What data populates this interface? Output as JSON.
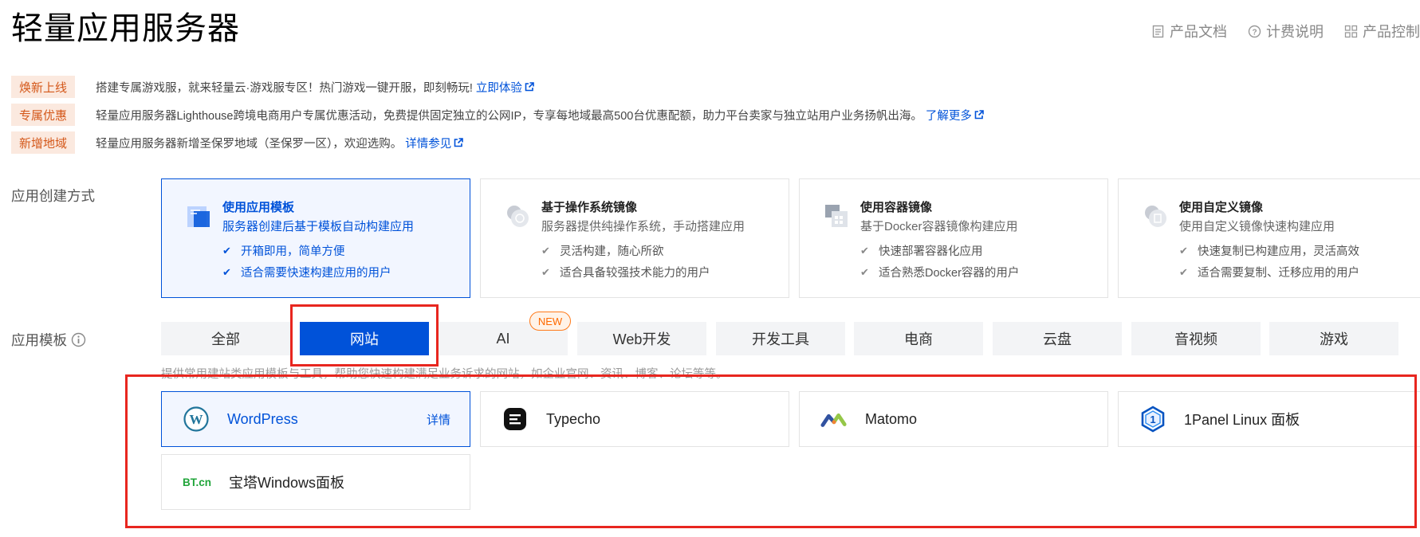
{
  "page": {
    "title": "轻量应用服务器"
  },
  "top_links": [
    {
      "label": "产品文档",
      "icon": "document-icon"
    },
    {
      "label": "计费说明",
      "icon": "question-circle-icon"
    },
    {
      "label": "产品控制台",
      "icon": "grid-icon"
    }
  ],
  "notices": [
    {
      "tag": "焕新上线",
      "text": "搭建专属游戏服，就来轻量云·游戏服专区！热门游戏一键开服，即刻畅玩!",
      "link": "立即体验"
    },
    {
      "tag": "专属优惠",
      "text": "轻量应用服务器Lighthouse跨境电商用户专属优惠活动，免费提供固定独立的公网IP，专享每地域最高500台优惠配额，助力平台卖家与独立站用户业务扬帆出海。",
      "link": "了解更多"
    },
    {
      "tag": "新增地域",
      "text": "轻量应用服务器新增圣保罗地域（圣保罗一区），欢迎选购。",
      "link": "详情参见"
    }
  ],
  "creation": {
    "label": "应用创建方式",
    "methods": [
      {
        "title": "使用应用模板",
        "desc": "服务器创建后基于模板自动构建应用",
        "features": [
          "开箱即用，简单方便",
          "适合需要快速构建应用的用户"
        ]
      },
      {
        "title": "基于操作系统镜像",
        "desc": "服务器提供纯操作系统，手动搭建应用",
        "features": [
          "灵活构建，随心所欲",
          "适合具备较强技术能力的用户"
        ]
      },
      {
        "title": "使用容器镜像",
        "desc": "基于Docker容器镜像构建应用",
        "features": [
          "快速部署容器化应用",
          "适合熟悉Docker容器的用户"
        ]
      },
      {
        "title": "使用自定义镜像",
        "desc": "使用自定义镜像快速构建应用",
        "features": [
          "快速复制已构建应用，灵活高效",
          "适合需要复制、迁移应用的用户"
        ]
      }
    ]
  },
  "templates": {
    "label": "应用模板",
    "tabs": [
      "全部",
      "网站",
      "AI",
      "Web开发",
      "开发工具",
      "电商",
      "云盘",
      "音视频",
      "游戏"
    ],
    "active_tab": "网站",
    "new_badge": "NEW",
    "description": "提供常用建站类应用模板与工具，帮助您快速构建满足业务诉求的网站，如企业官网、资讯、博客、论坛等等。",
    "items": [
      {
        "name": "WordPress",
        "detail": "详情",
        "icon": "wordpress-icon"
      },
      {
        "name": "Typecho",
        "icon": "typecho-icon"
      },
      {
        "name": "Matomo",
        "icon": "matomo-icon"
      },
      {
        "name": "1Panel Linux 面板",
        "icon": "1panel-icon"
      },
      {
        "name": "宝塔Windows面板",
        "icon": "bt-icon",
        "logo_text": "BT.cn"
      }
    ]
  },
  "colors": {
    "accent": "#0052d9",
    "tag_bg": "#fbe9df",
    "tag_text": "#d4581a",
    "annotation": "#e8261f",
    "new_badge": "#ff6a00"
  }
}
